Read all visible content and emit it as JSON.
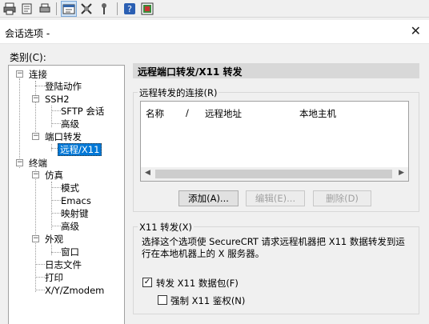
{
  "dialog": {
    "title": "会话选项 -",
    "close_glyph": "✕"
  },
  "category": {
    "label": "类别(C):"
  },
  "tree": {
    "connection": "连接",
    "login_action": "登陆动作",
    "ssh2": "SSH2",
    "sftp_session": "SFTP 会话",
    "ssh2_advanced": "高级",
    "port_forward": "端口转发",
    "remote_x11": "远程/X11",
    "terminal": "终端",
    "emulation": "仿真",
    "mode": "模式",
    "emacs": "Emacs",
    "mapped_keys": "映射键",
    "emulation_advanced": "高级",
    "appearance": "外观",
    "window": "窗口",
    "log_file": "日志文件",
    "print": "打印",
    "xyz_modem": "X/Y/Zmodem"
  },
  "panel": {
    "header": "远程端口转发/X11 转发",
    "connections_group": "远程转发的连接(R)",
    "columns": {
      "name": "名称",
      "sort_indicator": "/",
      "remote_address": "远程地址",
      "local_host": "本地主机"
    },
    "buttons": {
      "add": "添加(A)...",
      "edit": "编辑(E)...",
      "delete": "删除(D)"
    },
    "x11_group": "X11 转发(X)",
    "x11_description": "选择这个选项使 SecureCRT 请求远程机器把 X11 数据转发到运行在本地机器上的 X 服务器。",
    "forward_x11_label": "转发 X11 数据包(F)",
    "forward_x11_checked": true,
    "force_x11_auth_label": "强制 X11 鉴权(N)",
    "force_x11_auth_checked": false,
    "checkmark_glyph": "✓"
  },
  "toolbar": {
    "icons": [
      "print-icon",
      "print-setup-icon",
      "printer-icon",
      "session-options-icon",
      "global-options-icon",
      "keymap-icon",
      "help-icon",
      "about-icon"
    ]
  }
}
